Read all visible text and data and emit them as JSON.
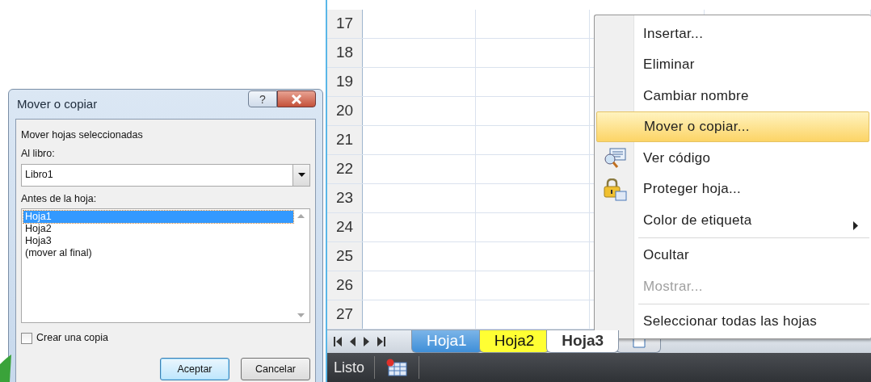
{
  "dialog": {
    "title": "Mover o copiar",
    "help_button": "?",
    "heading": "Mover hojas seleccionadas",
    "book_label": "Al libro:",
    "book_value": "Libro1",
    "sheet_label": "Antes de la hoja:",
    "sheets": [
      {
        "label": "Hoja1",
        "selected": true
      },
      {
        "label": "Hoja2",
        "selected": false
      },
      {
        "label": "Hoja3",
        "selected": false
      },
      {
        "label": "(mover al final)",
        "selected": false
      }
    ],
    "copy_checkbox": {
      "label": "Crear una copia",
      "checked": false
    },
    "buttons": [
      {
        "label": "Aceptar",
        "default": true
      },
      {
        "label": "Cancelar",
        "default": false
      }
    ]
  },
  "spreadsheet": {
    "row_numbers": [
      "17",
      "18",
      "19",
      "20",
      "21",
      "22",
      "23",
      "24",
      "25",
      "26",
      "27"
    ]
  },
  "sheet_tabs": [
    {
      "label": "Hoja1",
      "selected": false,
      "color": "#3f8fd8"
    },
    {
      "label": "Hoja2",
      "selected": false,
      "color": "#ffff33"
    },
    {
      "label": "Hoja3",
      "selected": true,
      "color": "#ffffff"
    }
  ],
  "status_bar": {
    "text": "Listo"
  },
  "context_menu": [
    {
      "kind": "item",
      "label": "Insertar...",
      "selected": false,
      "disabled": false,
      "submenu": false
    },
    {
      "kind": "item",
      "label": "Eliminar",
      "selected": false,
      "disabled": false,
      "submenu": false
    },
    {
      "kind": "item",
      "label": "Cambiar nombre",
      "selected": false,
      "disabled": false,
      "submenu": false
    },
    {
      "kind": "item",
      "label": "Mover o copiar...",
      "selected": true,
      "disabled": false,
      "submenu": false
    },
    {
      "kind": "code",
      "label": "Ver código",
      "selected": false,
      "disabled": false,
      "submenu": false
    },
    {
      "kind": "protect",
      "label": "Proteger hoja...",
      "selected": false,
      "disabled": false,
      "submenu": false
    },
    {
      "kind": "item",
      "label": "Color de etiqueta",
      "selected": false,
      "disabled": false,
      "submenu": true
    },
    {
      "kind": "separator"
    },
    {
      "kind": "item",
      "label": "Ocultar",
      "selected": false,
      "disabled": false,
      "submenu": false
    },
    {
      "kind": "item",
      "label": "Mostrar...",
      "selected": false,
      "disabled": true,
      "submenu": false
    },
    {
      "kind": "separator"
    },
    {
      "kind": "item",
      "label": "Seleccionar todas las hojas",
      "selected": false,
      "disabled": false,
      "submenu": false
    }
  ]
}
